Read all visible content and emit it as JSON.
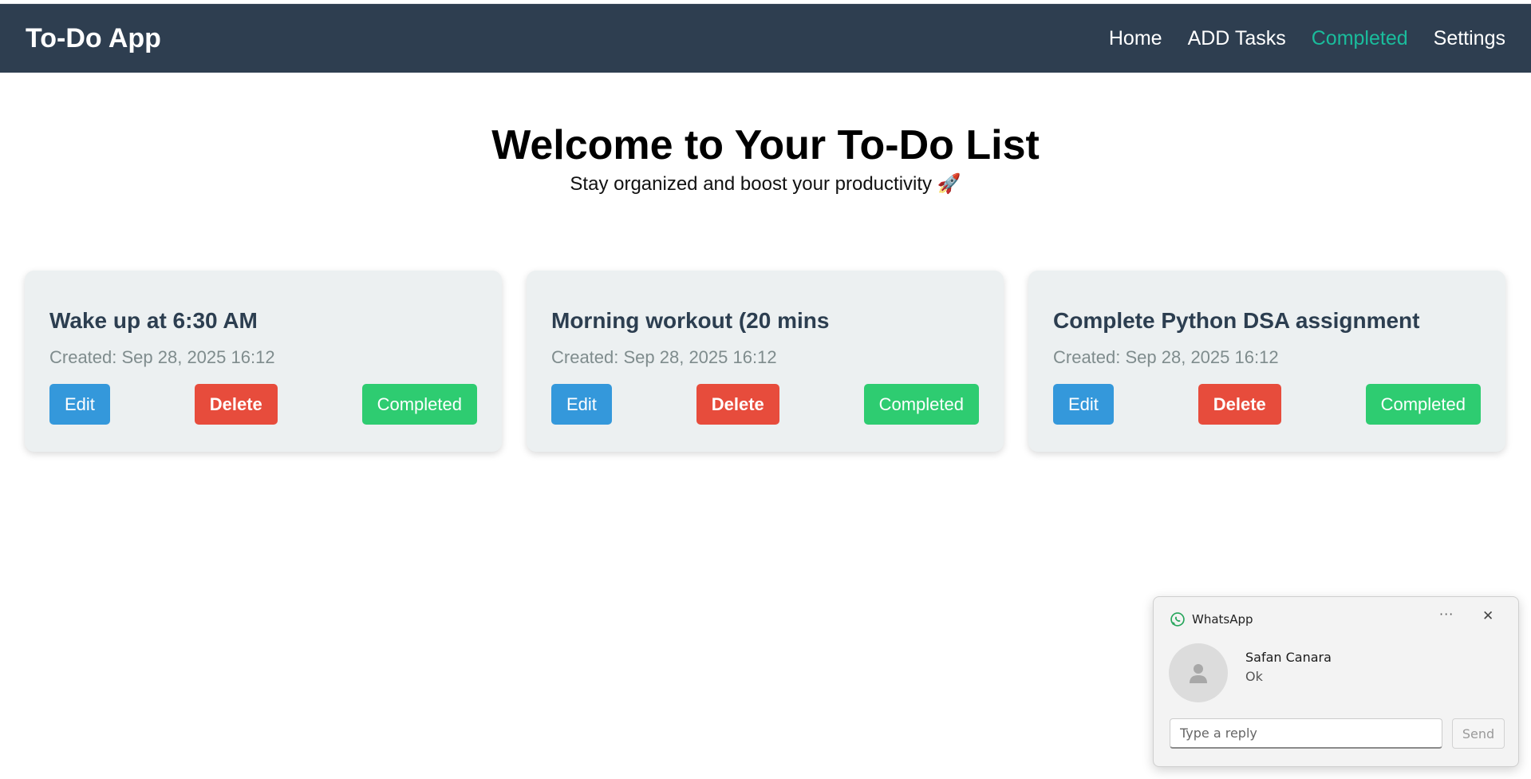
{
  "navbar": {
    "brand": "To-Do App",
    "links": [
      {
        "label": "Home"
      },
      {
        "label": "ADD Tasks"
      },
      {
        "label": "Completed",
        "active": true
      },
      {
        "label": "Settings"
      }
    ]
  },
  "hero": {
    "title": "Welcome to Your To-Do List",
    "subtitle": "Stay organized and boost your productivity 🚀"
  },
  "tasks": [
    {
      "title": "Wake up at 6:30 AM",
      "created": "Created: Sep 28, 2025 16:12",
      "edit_label": "Edit",
      "delete_label": "Delete",
      "complete_label": "Completed"
    },
    {
      "title": "Morning workout (20 mins",
      "created": "Created: Sep 28, 2025 16:12",
      "edit_label": "Edit",
      "delete_label": "Delete",
      "complete_label": "Completed"
    },
    {
      "title": "Complete Python DSA assignment",
      "created": "Created: Sep 28, 2025 16:12",
      "edit_label": "Edit",
      "delete_label": "Delete",
      "complete_label": "Completed"
    }
  ],
  "notification": {
    "app_name": "WhatsApp",
    "app_icon": "whatsapp-icon",
    "more_label": "···",
    "close_icon": "close-icon",
    "sender": "Safan Canara",
    "message": "Ok",
    "reply_placeholder": "Type a reply",
    "send_label": "Send"
  },
  "colors": {
    "navbar_bg": "#2e3e50",
    "nav_active": "#1abc9c",
    "card_bg": "#ecf0f1",
    "edit": "#3498db",
    "delete": "#e74c3c",
    "complete": "#2ecc71"
  }
}
